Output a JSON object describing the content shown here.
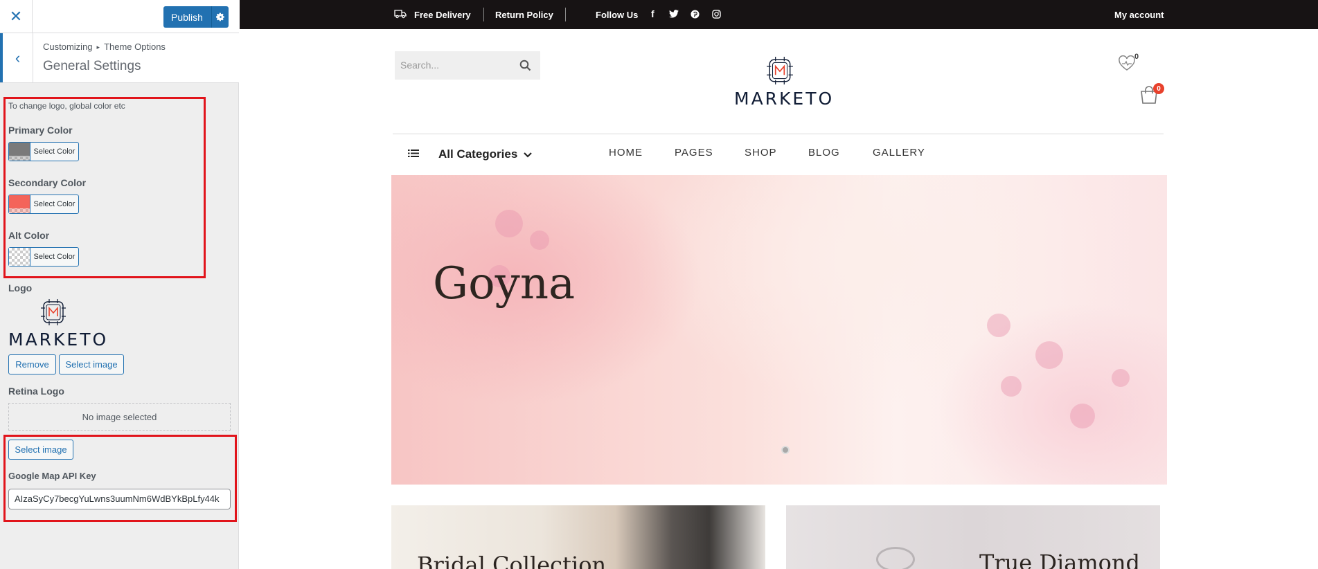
{
  "customizer": {
    "publish_label": "Publish",
    "breadcrumb": [
      "Customizing",
      "Theme Options"
    ],
    "section_title": "General Settings",
    "description": "To change logo, global color etc",
    "colors": [
      {
        "label": "Primary Color",
        "button_label": "Select Color",
        "value": "#7a7a7a"
      },
      {
        "label": "Secondary Color",
        "button_label": "Select Color",
        "value": "#f4645a"
      },
      {
        "label": "Alt Color",
        "button_label": "Select Color",
        "value": "transparent"
      }
    ],
    "logo": {
      "label": "Logo",
      "logo_text": "MARKETO",
      "remove_label": "Remove",
      "select_label": "Select image"
    },
    "retina_logo": {
      "label": "Retina Logo",
      "placeholder": "No image selected",
      "select_label": "Select image"
    },
    "map_key": {
      "label": "Google Map API Key",
      "value": "AIzaSyCy7becgYuLwns3uumNm6WdBYkBpLfy44k"
    }
  },
  "site": {
    "topbar": {
      "free_delivery": "Free Delivery",
      "return_policy": "Return Policy",
      "follow_us": "Follow Us",
      "social_icons": [
        "facebook-icon",
        "twitter-icon",
        "pinterest-icon",
        "instagram-icon"
      ],
      "my_account": "My account"
    },
    "search_placeholder": "Search...",
    "logo_text": "MARKETO",
    "wishlist_count": "0",
    "cart_count": "0",
    "categories_label": "All Categories",
    "nav": [
      "HOME",
      "PAGES",
      "SHOP",
      "BLOG",
      "GALLERY"
    ],
    "hero_title": "Goyna",
    "promos": [
      "Bridal Collection",
      "True Diamond"
    ],
    "colors": {
      "accent": "#2271b1",
      "badge": "#e8412c",
      "topbar": "#171314"
    }
  }
}
